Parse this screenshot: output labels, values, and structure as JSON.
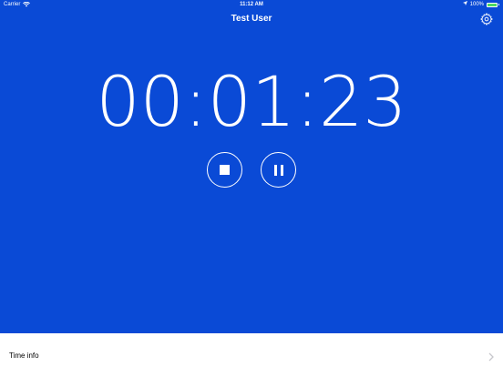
{
  "status_bar": {
    "carrier": "Carrier",
    "time": "11:12 AM",
    "battery_percent": "100%",
    "battery_level": 1.0,
    "icons": [
      "wifi-icon",
      "location-arrow-icon",
      "battery-icon"
    ]
  },
  "nav": {
    "title": "Test User",
    "settings_icon": "gear-icon"
  },
  "timer": {
    "display": "00:01:23"
  },
  "controls": {
    "stop_icon": "stop-icon",
    "pause_icon": "pause-icon"
  },
  "info_row": {
    "label": "Time info",
    "icon": "chevron-right-icon"
  },
  "colors": {
    "background": "#0A4AD6",
    "foreground": "#FFFFFF",
    "battery": "#4CD964",
    "info_background": "#FFFFFF"
  }
}
